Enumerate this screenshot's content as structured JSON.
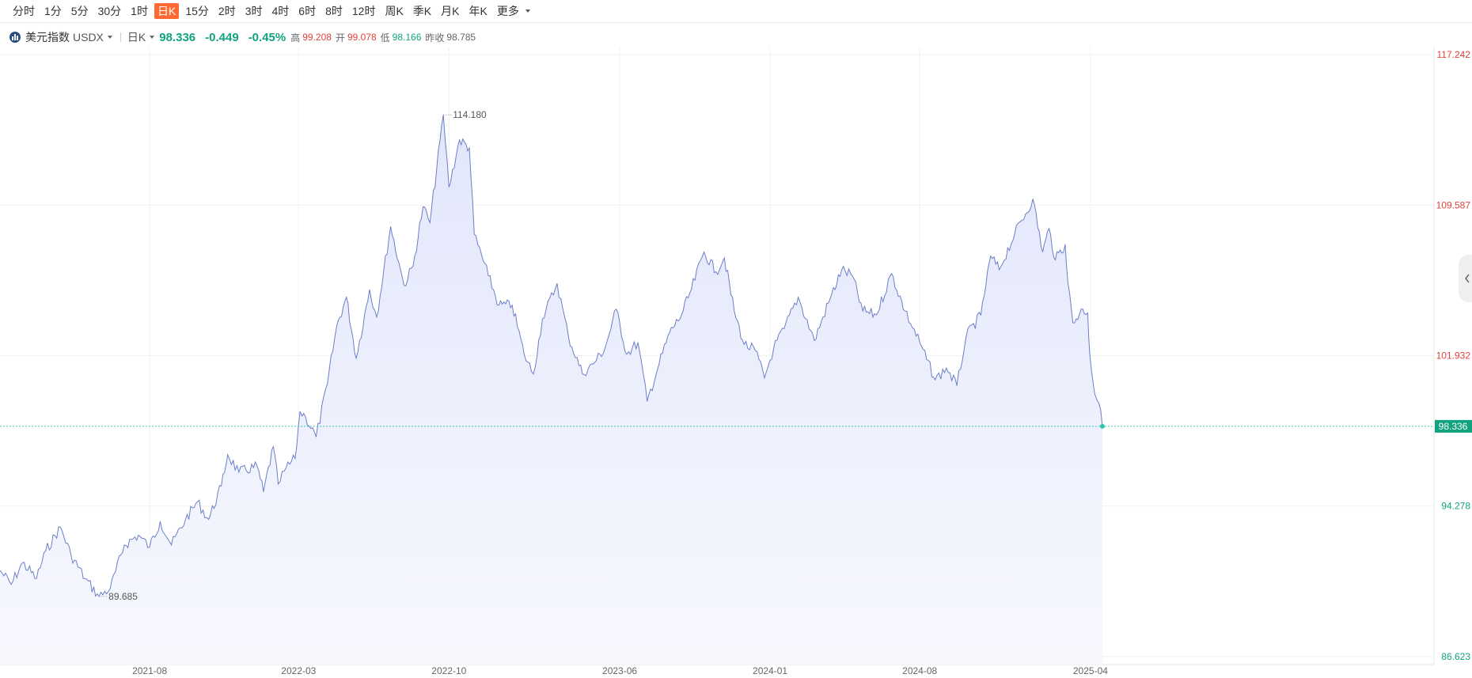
{
  "toolbar": {
    "periods": [
      "分时",
      "1分",
      "5分",
      "30分",
      "1时",
      "日K",
      "15分",
      "2时",
      "3时",
      "4时",
      "6时",
      "8时",
      "12时",
      "周K",
      "季K",
      "月K",
      "年K",
      "更多"
    ],
    "active": "日K"
  },
  "quote": {
    "name": "美元指数",
    "code": "USDX",
    "period": "日K",
    "price": "98.336",
    "change": "-0.449",
    "change_pct": "-0.45%",
    "high_label": "高",
    "high": "99.208",
    "open_label": "开",
    "open": "99.078",
    "low_label": "低",
    "low": "98.166",
    "prev_label": "昨收",
    "prev": "98.785"
  },
  "colors": {
    "up": "#e0443a",
    "down": "#11a37f",
    "line": "#6b7fc7",
    "fill": "#e6e9fb",
    "active_tab": "#ff6a33"
  },
  "icons": {
    "collapse": "chevron-left-icon",
    "logo": "bar-chart-logo-icon"
  },
  "chart_data": {
    "type": "area",
    "x_ticks": [
      "2021-08",
      "2022-03",
      "2022-10",
      "2023-06",
      "2024-01",
      "2024-08",
      "2025-04"
    ],
    "y_ticks": [
      {
        "value": 117.242,
        "label": "117.242",
        "color": "up"
      },
      {
        "value": 109.587,
        "label": "109.587",
        "color": "up"
      },
      {
        "value": 101.932,
        "label": "101.932",
        "color": "up"
      },
      {
        "value": 94.278,
        "label": "94.278",
        "color": "down"
      },
      {
        "value": 86.623,
        "label": "86.623",
        "color": "down"
      }
    ],
    "ylim": [
      86.623,
      117.242
    ],
    "last_price": {
      "value": 98.336,
      "label": "98.336"
    },
    "annotations": [
      {
        "date": "2022-09-27",
        "value": 114.18,
        "label": "114.180"
      },
      {
        "date": "2021-05-25",
        "value": 89.685,
        "label": "89.685"
      }
    ],
    "series": [
      {
        "points": [
          [
            "2021-01-04",
            91.0
          ],
          [
            "2021-01-20",
            90.3
          ],
          [
            "2021-02-05",
            91.4
          ],
          [
            "2021-02-25",
            90.6
          ],
          [
            "2021-03-10",
            92.0
          ],
          [
            "2021-03-31",
            93.2
          ],
          [
            "2021-04-15",
            91.8
          ],
          [
            "2021-05-05",
            90.6
          ],
          [
            "2021-05-25",
            89.685
          ],
          [
            "2021-06-10",
            90.1
          ],
          [
            "2021-06-30",
            92.3
          ],
          [
            "2021-07-20",
            92.8
          ],
          [
            "2021-08-05",
            92.2
          ],
          [
            "2021-08-20",
            93.5
          ],
          [
            "2021-09-05",
            92.3
          ],
          [
            "2021-09-25",
            93.6
          ],
          [
            "2021-10-12",
            94.5
          ],
          [
            "2021-10-28",
            93.6
          ],
          [
            "2021-11-15",
            95.3
          ],
          [
            "2021-11-24",
            96.9
          ],
          [
            "2021-12-10",
            96.0
          ],
          [
            "2022-01-05",
            96.3
          ],
          [
            "2022-01-14",
            95.0
          ],
          [
            "2022-01-28",
            97.3
          ],
          [
            "2022-02-04",
            95.4
          ],
          [
            "2022-02-15",
            96.2
          ],
          [
            "2022-02-28",
            96.7
          ],
          [
            "2022-03-07",
            99.1
          ],
          [
            "2022-03-15",
            98.8
          ],
          [
            "2022-03-30",
            97.8
          ],
          [
            "2022-04-15",
            100.5
          ],
          [
            "2022-04-28",
            103.4
          ],
          [
            "2022-05-12",
            104.9
          ],
          [
            "2022-05-26",
            101.8
          ],
          [
            "2022-06-14",
            105.3
          ],
          [
            "2022-06-24",
            103.9
          ],
          [
            "2022-07-14",
            108.5
          ],
          [
            "2022-07-28",
            106.3
          ],
          [
            "2022-08-02",
            105.5
          ],
          [
            "2022-08-15",
            106.5
          ],
          [
            "2022-08-29",
            109.5
          ],
          [
            "2022-09-08",
            108.7
          ],
          [
            "2022-09-27",
            114.18
          ],
          [
            "2022-10-05",
            110.5
          ],
          [
            "2022-10-20",
            112.9
          ],
          [
            "2022-11-03",
            112.5
          ],
          [
            "2022-11-10",
            108.1
          ],
          [
            "2022-11-30",
            106.0
          ],
          [
            "2022-12-15",
            104.5
          ],
          [
            "2023-01-03",
            104.5
          ],
          [
            "2023-01-20",
            102.0
          ],
          [
            "2023-02-02",
            101.0
          ],
          [
            "2023-02-15",
            103.8
          ],
          [
            "2023-03-08",
            105.6
          ],
          [
            "2023-03-24",
            102.9
          ],
          [
            "2023-04-13",
            101.0
          ],
          [
            "2023-04-28",
            101.5
          ],
          [
            "2023-05-15",
            102.3
          ],
          [
            "2023-05-31",
            104.3
          ],
          [
            "2023-06-15",
            102.0
          ],
          [
            "2023-07-01",
            102.6
          ],
          [
            "2023-07-14",
            99.6
          ],
          [
            "2023-07-31",
            101.5
          ],
          [
            "2023-08-15",
            103.1
          ],
          [
            "2023-09-01",
            104.0
          ],
          [
            "2023-09-15",
            105.3
          ],
          [
            "2023-10-03",
            107.2
          ],
          [
            "2023-10-20",
            106.2
          ],
          [
            "2023-11-01",
            106.9
          ],
          [
            "2023-11-15",
            104.2
          ],
          [
            "2023-11-29",
            102.5
          ],
          [
            "2023-12-15",
            102.2
          ],
          [
            "2023-12-28",
            100.8
          ],
          [
            "2024-01-10",
            102.3
          ],
          [
            "2024-01-25",
            103.3
          ],
          [
            "2024-02-14",
            104.9
          ],
          [
            "2024-03-08",
            102.7
          ],
          [
            "2024-03-28",
            104.6
          ],
          [
            "2024-04-16",
            106.3
          ],
          [
            "2024-05-01",
            106.0
          ],
          [
            "2024-05-16",
            104.2
          ],
          [
            "2024-06-04",
            104.0
          ],
          [
            "2024-06-26",
            106.1
          ],
          [
            "2024-07-15",
            104.2
          ],
          [
            "2024-08-05",
            102.6
          ],
          [
            "2024-08-27",
            100.7
          ],
          [
            "2024-09-12",
            101.3
          ],
          [
            "2024-09-27",
            100.4
          ],
          [
            "2024-10-10",
            102.9
          ],
          [
            "2024-10-31",
            104.0
          ],
          [
            "2024-11-14",
            107.0
          ],
          [
            "2024-11-26",
            106.3
          ],
          [
            "2024-12-18",
            108.1
          ],
          [
            "2025-01-13",
            109.9
          ],
          [
            "2025-01-27",
            107.2
          ],
          [
            "2025-02-05",
            108.4
          ],
          [
            "2025-02-14",
            106.8
          ],
          [
            "2025-02-28",
            107.6
          ],
          [
            "2025-03-04",
            105.6
          ],
          [
            "2025-03-11",
            103.6
          ],
          [
            "2025-03-25",
            104.3
          ],
          [
            "2025-04-01",
            104.1
          ],
          [
            "2025-04-04",
            102.0
          ],
          [
            "2025-04-11",
            100.0
          ],
          [
            "2025-04-17",
            99.5
          ],
          [
            "2025-04-22",
            98.336
          ]
        ]
      }
    ]
  }
}
